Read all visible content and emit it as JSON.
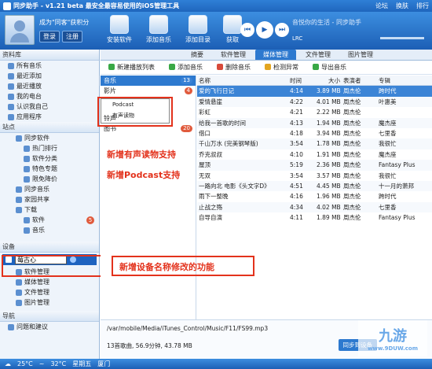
{
  "titlebar": {
    "title": "同步助手 - v1.21 beta  最安全最容易使用的iOS管理工具",
    "forum": "论坛",
    "skin": "换肤",
    "rank": "排行"
  },
  "user": {
    "greeting": "成为\"同客\"获积分",
    "login": "登录",
    "register": "注册"
  },
  "toolbar_top": [
    "安装软件",
    "添加音乐",
    "添加目录",
    "获取"
  ],
  "player": {
    "song": "音悦你的生活 - 同步助手",
    "lrc": "LRC"
  },
  "sidebar": {
    "library_title": "资料库",
    "library": [
      "所有音乐",
      "最近添加",
      "最近播放",
      "我的电台",
      "认识我自己",
      "应用程序"
    ],
    "site_title": "站点",
    "site": [
      {
        "label": "同步软件",
        "level": 2
      },
      {
        "label": "热门排行",
        "level": 3
      },
      {
        "label": "软件分类",
        "level": 3
      },
      {
        "label": "特色专题",
        "level": 3
      },
      {
        "label": "限免降价",
        "level": 3
      },
      {
        "label": "同步音乐",
        "level": 2
      },
      {
        "label": "家园共享",
        "level": 2
      },
      {
        "label": "下载",
        "level": 2
      },
      {
        "label": "软件",
        "level": 3,
        "badge": "5"
      },
      {
        "label": "音乐",
        "level": 3
      }
    ],
    "device_title": "设备",
    "device_name": "莓古心",
    "device_items": [
      "软件管理",
      "媒体管理",
      "文件管理",
      "图片管理"
    ],
    "nav_title": "导航",
    "nav_items": [
      "问题和建议"
    ]
  },
  "tabs": [
    "摘要",
    "软件管理",
    "媒体管理",
    "文件管理",
    "图片管理"
  ],
  "actions": [
    "新建播放列表",
    "添加音乐",
    "删除音乐",
    "检测异常",
    "导出音乐"
  ],
  "playlists": [
    {
      "label": "音乐",
      "count": "13"
    },
    {
      "label": "影片",
      "count": "4"
    },
    {
      "label": "铃声",
      "count": ""
    },
    {
      "label": "图书",
      "count": "20"
    }
  ],
  "popup": [
    "Podcast",
    "有声读物"
  ],
  "annotations": [
    "新增有声读物支持",
    "新增Podcast支持",
    "新增设备名称修改的功能"
  ],
  "columns": [
    "名称",
    "时间",
    "大小",
    "表演者",
    "专辑"
  ],
  "songs": [
    [
      "爱的飞行日记",
      "4:14",
      "3.89 MB",
      "周杰伦",
      "跨时代"
    ],
    [
      "爱情悬崖",
      "4:22",
      "4.01 MB",
      "周杰伦",
      "叶惠美"
    ],
    [
      "彩虹",
      "4:21",
      "2.22 MB",
      "周杰伦",
      ""
    ],
    [
      "给我一首歌的时间",
      "4:13",
      "1.94 MB",
      "周杰伦",
      "魔杰座"
    ],
    [
      "借口",
      "4:18",
      "3.94 MB",
      "周杰伦",
      "七里香"
    ],
    [
      "千山万水 (完美钢琴版)",
      "3:54",
      "1.78 MB",
      "周杰伦",
      "我很忙"
    ],
    [
      "乔克叔叔",
      "4:10",
      "1.91 MB",
      "周杰伦",
      "魔杰座"
    ],
    [
      "屋顶",
      "5:19",
      "2.36 MB",
      "周杰伦",
      "Fantasy Plus"
    ],
    [
      "无双",
      "3:54",
      "3.57 MB",
      "周杰伦",
      "我很忙"
    ],
    [
      "一路向北 电影《头文字D》",
      "4:51",
      "4.45 MB",
      "周杰伦",
      "十一月的萧邦"
    ],
    [
      "雨下一整晚",
      "4:16",
      "1.96 MB",
      "周杰伦",
      "跨时代"
    ],
    [
      "止战之殇",
      "4:34",
      "4.02 MB",
      "周杰伦",
      "七里香"
    ],
    [
      "自导自演",
      "4:11",
      "1.89 MB",
      "周杰伦",
      "Fantasy Plus"
    ]
  ],
  "path": "/var/mobile/Media/iTunes_Control/Music/F11/FS99.mp3",
  "summary": "13首歌曲, 56.9分钟, 43.78 MB",
  "sync_btn": "同步到设备",
  "statusbar": {
    "temp1": "25°C",
    "temp2": "32°C",
    "weekday": "星期五",
    "city": "厦门"
  },
  "watermark": {
    "logo": "九游",
    "url": "www.9DUW.com"
  }
}
